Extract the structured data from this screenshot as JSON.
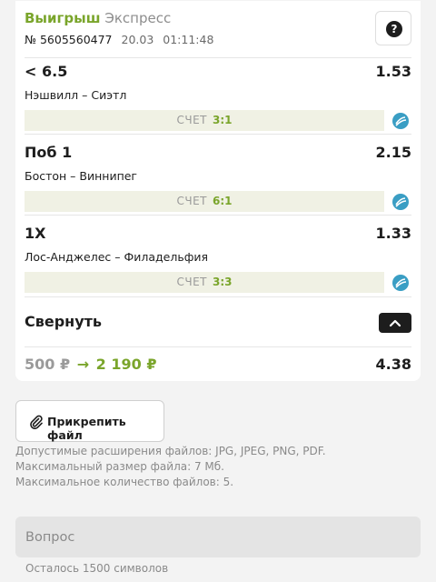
{
  "header": {
    "status": "Выигрыш",
    "bet_type": "Экспресс",
    "bet_id": "№ 5605560477",
    "date": "20.03",
    "time": "01:11:48",
    "help_glyph": "?",
    "help_icon": "question-circle-icon"
  },
  "bets": [
    {
      "pick": "< 6.5",
      "odd": "1.53",
      "teams": "Нэшвилл – Сиэтл",
      "score_label": "СЧЕТ",
      "score": "3:1",
      "sport_icon": "hockey-puck-icon"
    },
    {
      "pick": "Поб 1",
      "odd": "2.15",
      "teams": "Бостон – Виннипег",
      "score_label": "СЧЕТ",
      "score": "6:1",
      "sport_icon": "hockey-puck-icon"
    },
    {
      "pick": "1X",
      "odd": "1.33",
      "teams": "Лос-Анджелес – Филадельфия",
      "score_label": "СЧЕТ",
      "score": "3:3",
      "sport_icon": "hockey-puck-icon"
    }
  ],
  "collapse": {
    "label": "Свернуть",
    "icon": "chevron-up-icon"
  },
  "summary": {
    "stake": "500 ₽",
    "arrow": "→",
    "payout": "2 190 ₽",
    "total_odd": "4.38"
  },
  "attach": {
    "label": "Прикрепить файл",
    "icon": "paperclip-icon"
  },
  "rules": [
    "Допустимые расширения файлов: JPG, JPEG, PNG, PDF.",
    "Максимальный размер файла: 7 Мб.",
    "Максимальное количество файлов: 5."
  ],
  "question": {
    "placeholder": "Вопрос",
    "value": ""
  },
  "remaining": "Осталось 1500 символов",
  "colors": {
    "accent": "#7aa52b",
    "score_bg": "#f0f1e4",
    "puck": "#3a9ec4",
    "page_bg": "#f3f3f3"
  }
}
